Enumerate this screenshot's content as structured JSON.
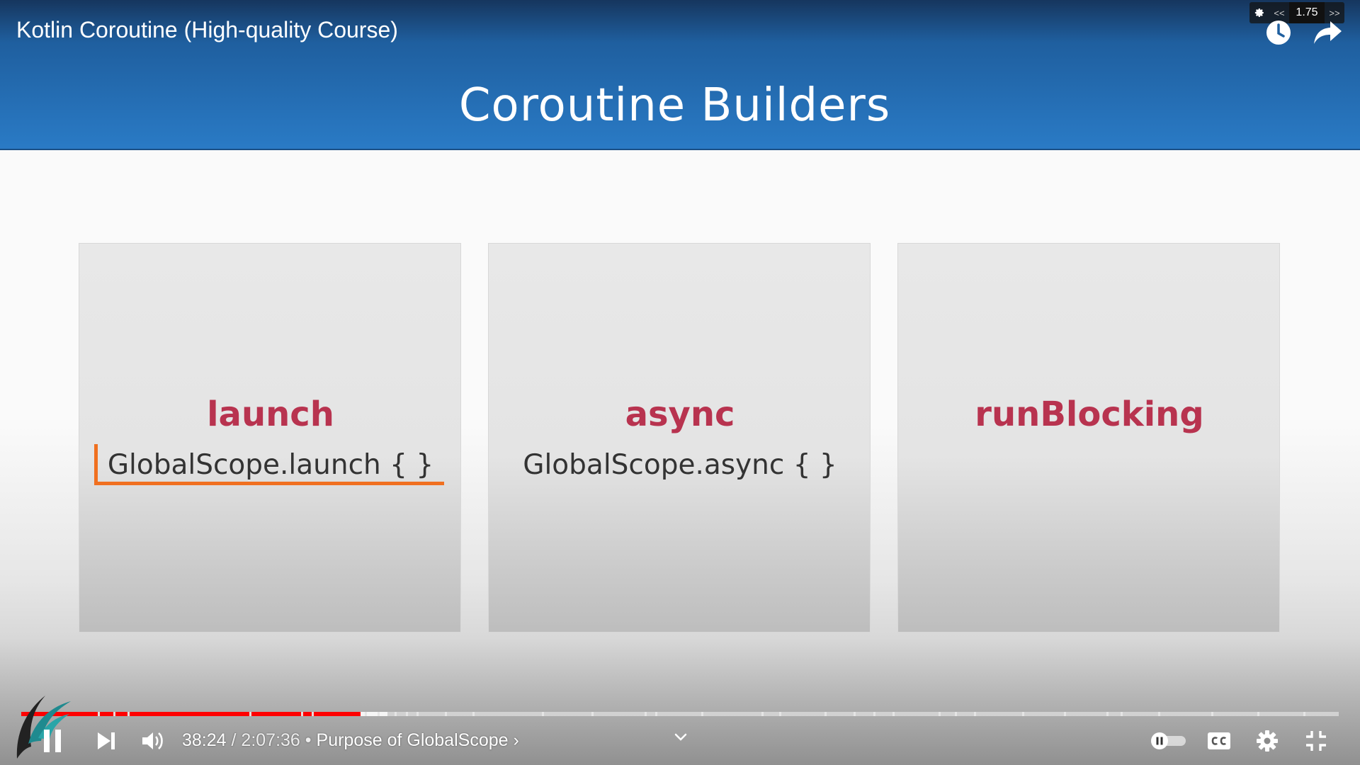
{
  "video": {
    "title": "Kotlin Coroutine (High-quality Course)",
    "current_time": "38:24",
    "duration": "2:07:36",
    "separator": "/",
    "bullet": "•",
    "chapter": "Purpose of GlobalScope",
    "chapter_arrow": "›",
    "progress_fraction": 0.2575,
    "buffered_fraction": 0.278
  },
  "speed_controller": {
    "decrease_label": "<<",
    "value": "1.75",
    "increase_label": ">>"
  },
  "slide": {
    "title": "Coroutine Builders",
    "cards": [
      {
        "heading": "launch",
        "code": "GlobalScope.launch { }"
      },
      {
        "heading": "async",
        "code": "GlobalScope.async { }"
      },
      {
        "heading": "runBlocking",
        "code": ""
      }
    ]
  },
  "colors": {
    "header_blue": "#2a7bc6",
    "heading_red": "#b8334f",
    "annotation_orange": "#f07020",
    "progress_red": "#ff0000"
  },
  "icons": [
    "gear-icon",
    "clock-icon",
    "share-icon",
    "pause-icon",
    "next-icon",
    "volume-icon",
    "chevron-down-icon",
    "autoplay-toggle-icon",
    "captions-icon",
    "settings-icon",
    "exit-fullscreen-icon"
  ]
}
